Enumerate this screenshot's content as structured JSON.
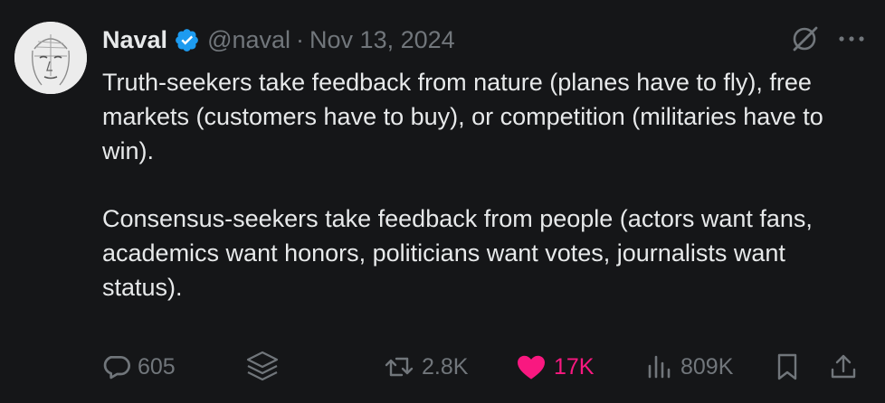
{
  "author": {
    "name": "Naval",
    "handle": "@naval",
    "date": "Nov 13, 2024",
    "verified": true
  },
  "tweet": {
    "paragraph_1": "Truth-seekers take feedback from nature (planes have to fly), free markets (customers have to buy), or competition (militaries have to win).",
    "paragraph_2": "Consensus-seekers take feedback from people (actors want fans, academics want honors, politicians want votes, journalists want status)."
  },
  "stats": {
    "replies": "605",
    "retweets": "2.8K",
    "likes": "17K",
    "views": "809K"
  },
  "icons": {
    "verified": "verified-badge-icon",
    "grok": "grok-icon",
    "more": "more-icon",
    "reply": "reply-icon",
    "layers": "layers-icon",
    "retweet": "retweet-icon",
    "like": "heart-icon",
    "views": "views-icon",
    "bookmark": "bookmark-icon",
    "share": "share-icon"
  },
  "colors": {
    "background": "#151618",
    "text": "#e7e9ea",
    "muted": "#71767b",
    "verified": "#1d9bf0",
    "like": "#f91880"
  }
}
